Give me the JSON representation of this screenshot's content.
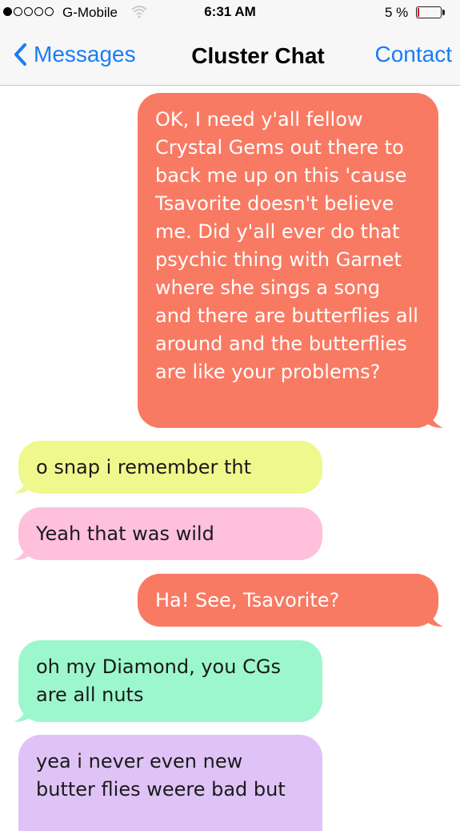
{
  "status_bar": {
    "carrier": "G-Mobile",
    "time": "6:31 AM",
    "battery_percent": "5 %",
    "signal_bars_filled": 1,
    "signal_bars_total": 5
  },
  "nav": {
    "back_label": "Messages",
    "title": "Cluster Chat",
    "contact_label": "Contact",
    "accent_color": "#1a7cf5"
  },
  "messages": [
    {
      "direction": "outgoing",
      "color": "#f97a63",
      "text": "OK, I need y'all fellow Crystal Gems out there to back me up on this 'cause Tsavorite doesn't believe me. Did y'all ever do that psychic thing with Garnet where she sings a song and there are butterflies all around and the butterflies are like your problems?"
    },
    {
      "direction": "incoming",
      "color": "#eef88c",
      "text": "o snap i remember tht"
    },
    {
      "direction": "incoming",
      "color": "#ffc0dc",
      "text": "Yeah that was wild"
    },
    {
      "direction": "outgoing",
      "color": "#f97a63",
      "text": "Ha! See, Tsavorite?"
    },
    {
      "direction": "incoming",
      "color": "#9cf7cc",
      "text": "oh my Diamond, you CGs are all nuts"
    },
    {
      "direction": "incoming",
      "color": "#dfc3f7",
      "text": "yea i never even new butter flies weere bad but"
    }
  ]
}
